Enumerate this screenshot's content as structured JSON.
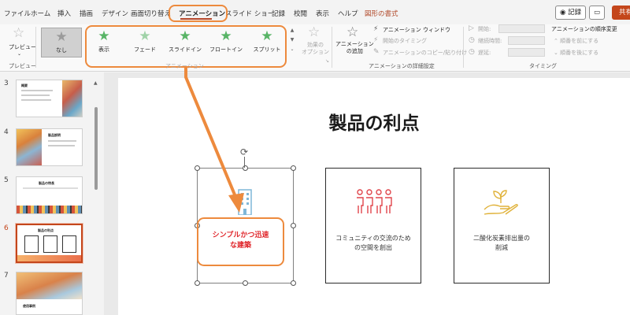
{
  "menu": {
    "tabs": [
      "ファイル",
      "ホーム",
      "挿入",
      "描画",
      "デザイン",
      "画面切り替え",
      "アニメーション",
      "スライド ショー",
      "記録",
      "校閲",
      "表示",
      "ヘルプ",
      "図形の書式"
    ],
    "record_button": "記録",
    "share_button": "共有"
  },
  "ribbon": {
    "preview": {
      "label": "プレビュー",
      "group": "プレビュー"
    },
    "animations": {
      "group": "アニメーション",
      "items": [
        "なし",
        "表示",
        "フェード",
        "スライドイン",
        "フロートイン",
        "スプリット"
      ],
      "effect_options": "効果の\nオプション"
    },
    "advanced": {
      "add_animation": "アニメーション\nの追加",
      "pane": "アニメーション ウィンドウ",
      "trigger": "開始のタイミング",
      "painter": "アニメーションのコピー/貼り付け",
      "group": "アニメーションの詳細設定"
    },
    "timing": {
      "start": "開始:",
      "duration": "継続時間:",
      "delay": "遅延:",
      "reorder_title": "アニメーションの順序変更",
      "move_earlier": "順番を前にする",
      "move_later": "順番を後にする",
      "group": "タイミング"
    }
  },
  "thumbnails": {
    "slides": [
      {
        "number": "3",
        "title": "概要"
      },
      {
        "number": "4",
        "title": "製品説明"
      },
      {
        "number": "5",
        "title": "製品の特長"
      },
      {
        "number": "6",
        "title": "製品の利点"
      },
      {
        "number": "7",
        "title": "使用事例"
      }
    ]
  },
  "slide": {
    "title": "製品の利点",
    "cards": [
      {
        "text": "シンプルかつ迅速\nな建築",
        "icon": "building-icon"
      },
      {
        "text": "コミュニティの交流のため\nの空間を創出",
        "icon": "people-icon"
      },
      {
        "text": "二酸化炭素排出量の\n削減",
        "icon": "plant-hand-icon"
      }
    ]
  },
  "colors": {
    "accent": "#c4461b",
    "callout": "#ed8a3d",
    "star_green": "#58b466",
    "card1_text": "#e0272c"
  }
}
